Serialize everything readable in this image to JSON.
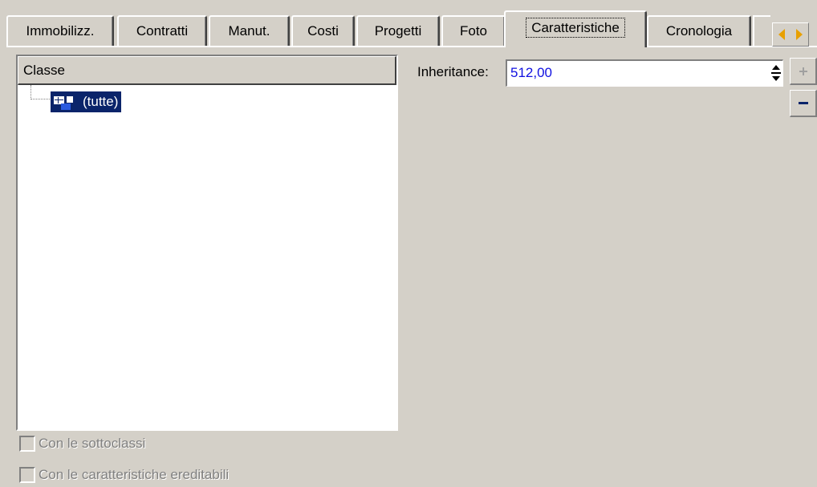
{
  "tabs": [
    {
      "label": "Immobilizz.",
      "active": false
    },
    {
      "label": "Contratti",
      "active": false
    },
    {
      "label": "Manut.",
      "active": false
    },
    {
      "label": "Costi",
      "active": false
    },
    {
      "label": "Progetti",
      "active": false
    },
    {
      "label": "Foto",
      "active": false
    },
    {
      "label": "Caratteristiche",
      "active": true
    },
    {
      "label": "Cronologia",
      "active": false
    }
  ],
  "tree": {
    "header": "Classe",
    "root_label": "(tutte)"
  },
  "checkboxes": [
    {
      "label": "Con le sottoclassi",
      "checked": false,
      "enabled": false
    },
    {
      "label": "Con le caratteristiche ereditabili",
      "checked": false,
      "enabled": false
    }
  ],
  "field": {
    "label": "Inheritance:",
    "value": "512,00"
  },
  "colors": {
    "background": "#d4d0c8",
    "selection": "#0a246a",
    "value_text": "#1010e0",
    "arrows": "#e8a000"
  },
  "icons": {
    "tab_scroll_left": "triangle-left-icon",
    "tab_scroll_right": "triangle-right-icon",
    "spinner": "up-down-spinner-icon",
    "add": "plus-icon",
    "remove": "minus-icon",
    "tree_node": "class-tree-icon"
  }
}
